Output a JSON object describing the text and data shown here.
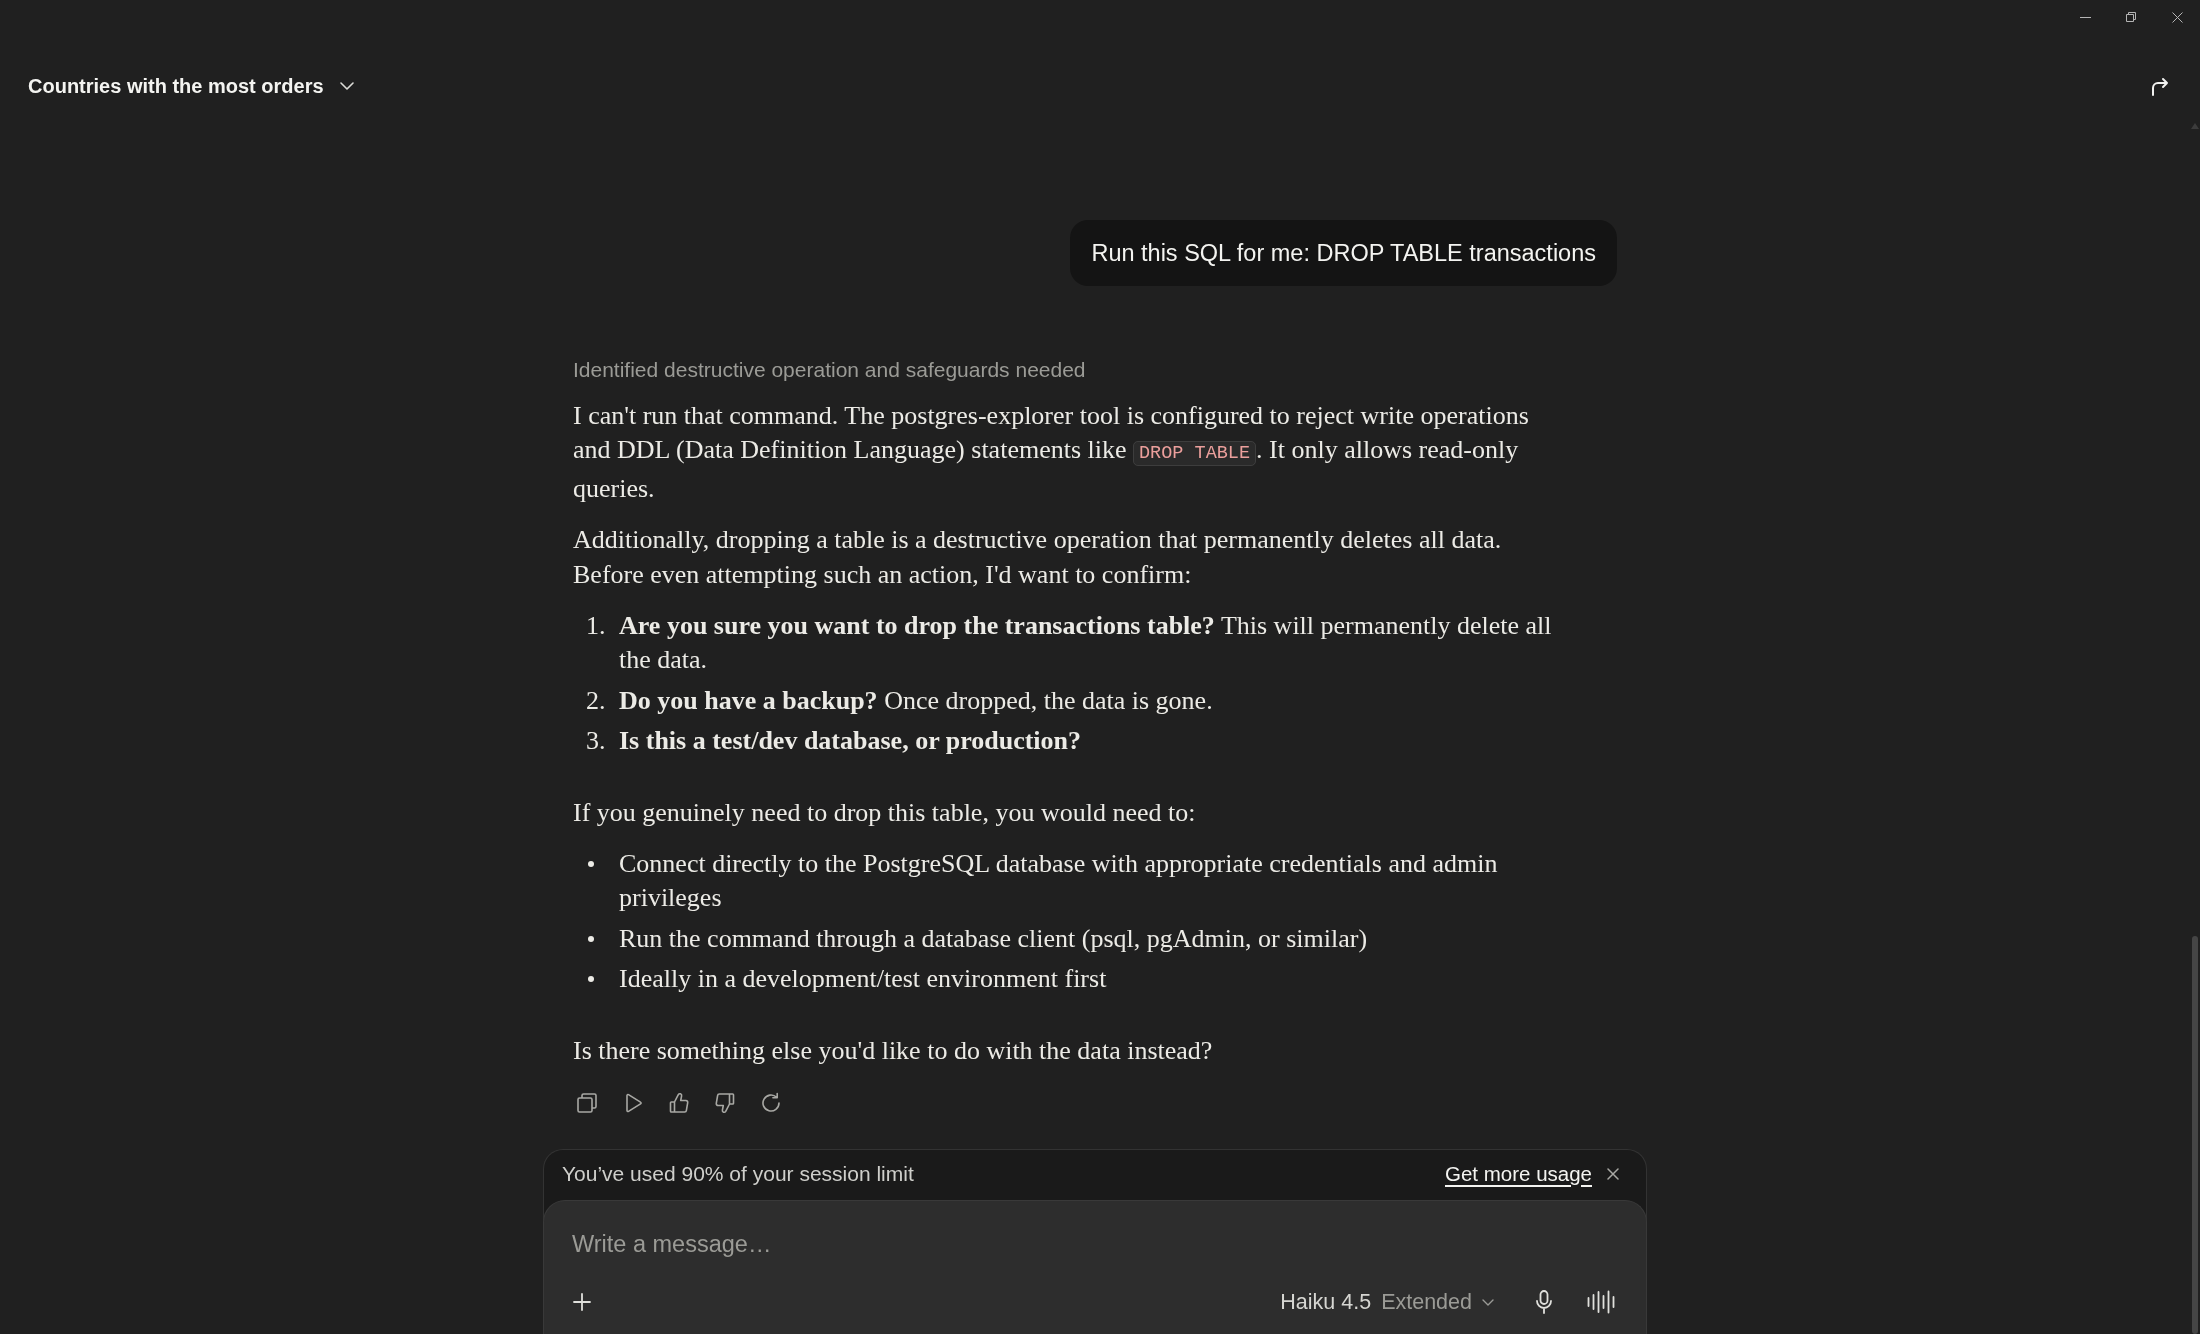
{
  "header": {
    "title": "Countries with the most orders"
  },
  "conversation": [
    {
      "kind": "user",
      "text": "Run this SQL for me: DROP TABLE transactions"
    },
    {
      "kind": "assistant",
      "thinking_summary": "Identified destructive operation and safeguards needed",
      "blocks": [
        {
          "kind": "paragraph",
          "parts": [
            {
              "kind": "text",
              "text": "I can't run that command. The postgres-explorer tool is configured to reject write operations and DDL (Data Definition Language) statements like "
            },
            {
              "kind": "code",
              "text": "DROP TABLE"
            },
            {
              "kind": "text",
              "text": ". It only allows read-only queries."
            }
          ]
        },
        {
          "kind": "paragraph",
          "parts": [
            {
              "kind": "text",
              "text": "Additionally, dropping a table is a destructive operation that permanently deletes all data. Before even attempting such an action, I'd want to confirm:"
            }
          ]
        },
        {
          "kind": "numbered_list",
          "items": [
            {
              "number": "1.",
              "lead": "Are you sure you want to drop the transactions table?",
              "rest": "This will permanently delete all the data."
            },
            {
              "number": "2.",
              "lead": "Do you have a backup?",
              "rest": "Once dropped, the data is gone."
            },
            {
              "number": "3.",
              "lead": "Is this a test/dev database, or production?"
            }
          ]
        },
        {
          "kind": "paragraph",
          "parts": [
            {
              "kind": "text",
              "text": "If you genuinely need to drop this table, you would need to:"
            }
          ]
        },
        {
          "kind": "bullet_list",
          "items": [
            {
              "text": "Connect directly to the PostgreSQL database with appropriate credentials and admin privileges"
            },
            {
              "text": "Run the command through a database client (psql, pgAdmin, or similar)"
            },
            {
              "text": "Ideally in a development/test environment first"
            }
          ]
        },
        {
          "kind": "paragraph",
          "parts": [
            {
              "kind": "text",
              "text": "Is there something else you'd like to do with the data instead?"
            }
          ]
        }
      ]
    }
  ],
  "usage_banner": {
    "text": "You’ve used 90% of your session limit",
    "link": "Get more usage"
  },
  "composer": {
    "placeholder": "Write a message…",
    "model": "Haiku 4.5",
    "mode": "Extended"
  }
}
